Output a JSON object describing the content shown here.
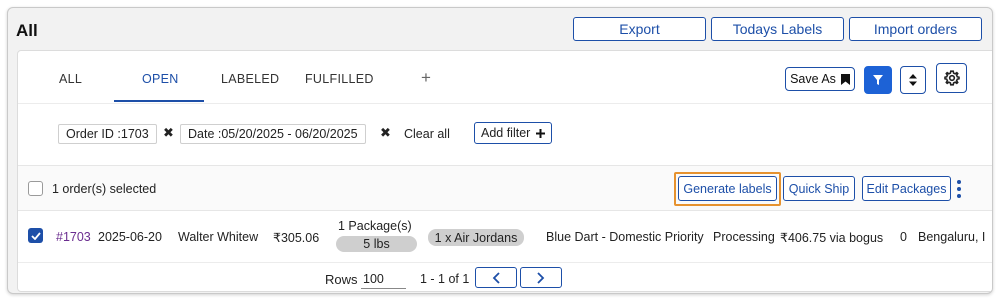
{
  "header": {
    "title": "All",
    "buttons": {
      "export": "Export",
      "todays_labels": "Todays Labels",
      "import_orders": "Import orders"
    }
  },
  "tabs": [
    "ALL",
    "OPEN",
    "LABELED",
    "FULFILLED"
  ],
  "active_tab": "OPEN",
  "add_tab_symbol": "+",
  "toolbar": {
    "save_as": "Save As"
  },
  "filters": {
    "chips": [
      "Order ID :1703",
      "Date :05/20/2025 - 06/20/2025"
    ],
    "remove_symbol": "✖",
    "clear_all": "Clear all",
    "add_filter": "Add filter"
  },
  "bulk": {
    "selected_text": "1 order(s) selected",
    "actions": {
      "generate_labels": "Generate labels",
      "quick_ship": "Quick Ship",
      "edit_packages": "Edit Packages"
    }
  },
  "order_row": {
    "order_id": "#1703",
    "date": "2025-06-20",
    "customer": "Walter Whitew",
    "amount": "₹305.06",
    "packages": "1 Package(s)",
    "weight": "5 lbs",
    "items": "1 x Air Jordans",
    "carrier": "Blue Dart - Domestic Priority",
    "status": "Processing",
    "shipping": "₹406.75 via bogus",
    "count": "0",
    "city": "Bengaluru, I"
  },
  "pagination": {
    "rows_label": "Rows",
    "rows_value": "100",
    "range": "1 - 1 of 1"
  },
  "colors": {
    "accent": "#1d4fa8",
    "highlight": "#e6922f",
    "link": "#6a2c8f",
    "pill": "#cfcfcf"
  }
}
